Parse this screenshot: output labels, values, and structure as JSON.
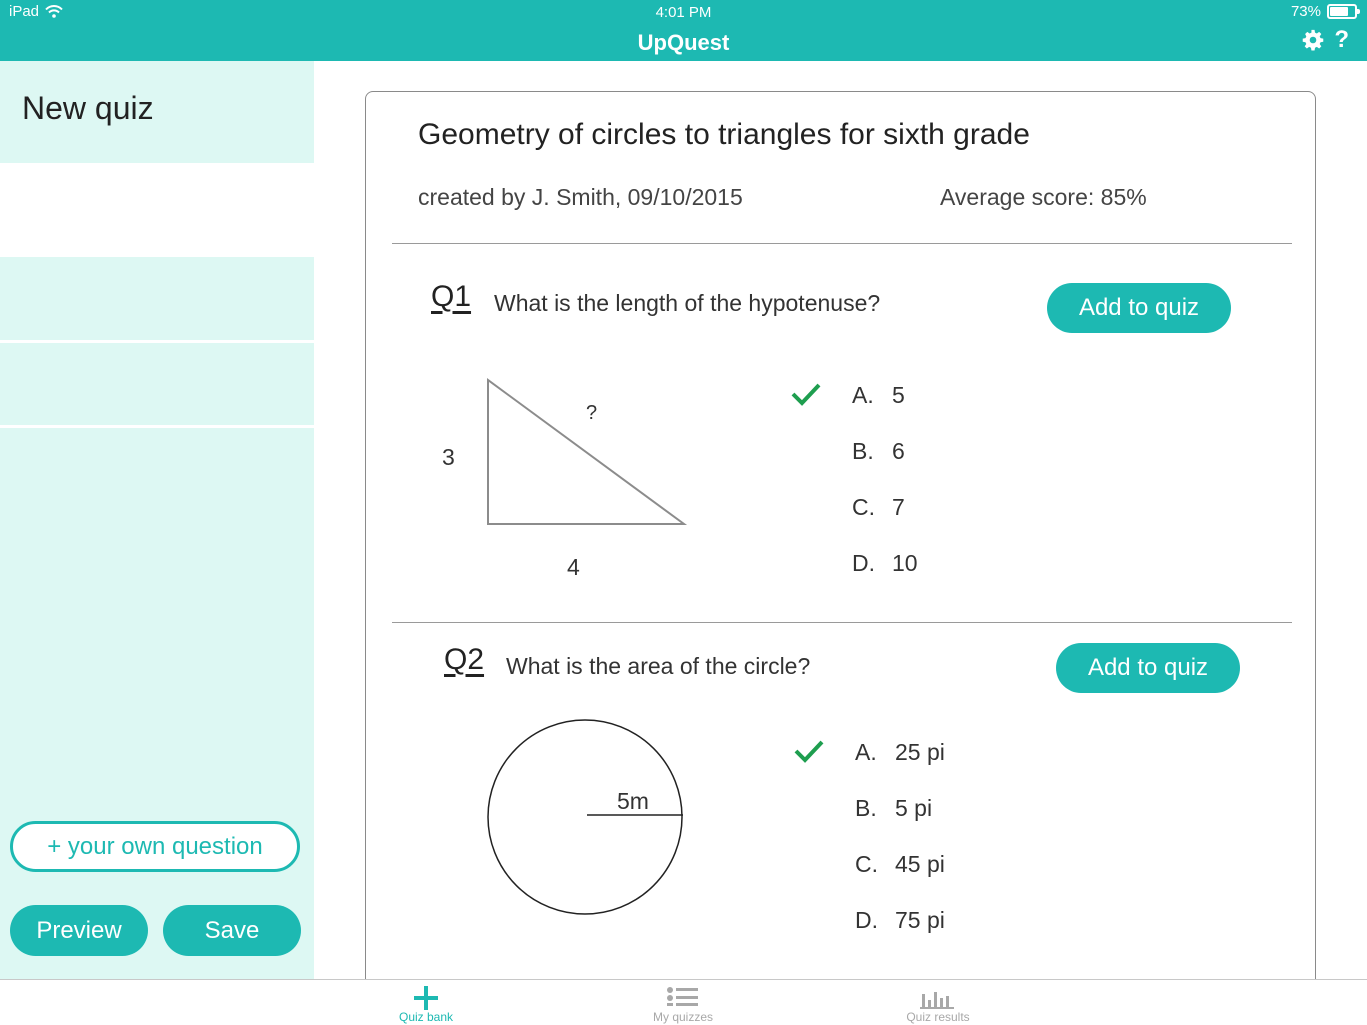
{
  "status_bar": {
    "device": "iPad",
    "time": "4:01 PM",
    "battery": "73%",
    "battery_level": 0.73
  },
  "header": {
    "title": "UpQuest",
    "settings_icon": "gear-icon",
    "help_label": "?"
  },
  "sidebar": {
    "title": "New quiz",
    "own_question_label": "+ your own question",
    "preview_label": "Preview",
    "save_label": "Save"
  },
  "quiz": {
    "title": "Geometry of circles to triangles for sixth grade",
    "created_by": "created by J. Smith, 09/10/2015",
    "average_score": "Average score: 85%",
    "questions": [
      {
        "number": "Q1",
        "text": "What is the length of the hypotenuse?",
        "add_label": "Add to quiz",
        "figure_labels": {
          "side_a": "3",
          "side_b": "4",
          "hypotenuse": "?"
        },
        "answers": [
          {
            "letter": "A.",
            "value": "5",
            "correct": true
          },
          {
            "letter": "B.",
            "value": "6",
            "correct": false
          },
          {
            "letter": "C.",
            "value": "7",
            "correct": false
          },
          {
            "letter": "D.",
            "value": "10",
            "correct": false
          }
        ]
      },
      {
        "number": "Q2",
        "text": "What is the area of the circle?",
        "add_label": "Add to quiz",
        "figure_labels": {
          "radius": "5m"
        },
        "answers": [
          {
            "letter": "A.",
            "value": "25 pi",
            "correct": true
          },
          {
            "letter": "B.",
            "value": "5 pi",
            "correct": false
          },
          {
            "letter": "C.",
            "value": "45 pi",
            "correct": false
          },
          {
            "letter": "D.",
            "value": "75 pi",
            "correct": false
          }
        ]
      }
    ]
  },
  "tabs": [
    {
      "label": "Quiz bank",
      "icon": "plus-icon",
      "active": true
    },
    {
      "label": "My quizzes",
      "icon": "list-icon",
      "active": false
    },
    {
      "label": "Quiz results",
      "icon": "bar-chart-icon",
      "active": false
    }
  ],
  "colors": {
    "accent": "#1db9b2",
    "sidebar_bg": "#ddf8f3",
    "check": "#1e9e4f",
    "tab_inactive": "#a8a8a8"
  }
}
